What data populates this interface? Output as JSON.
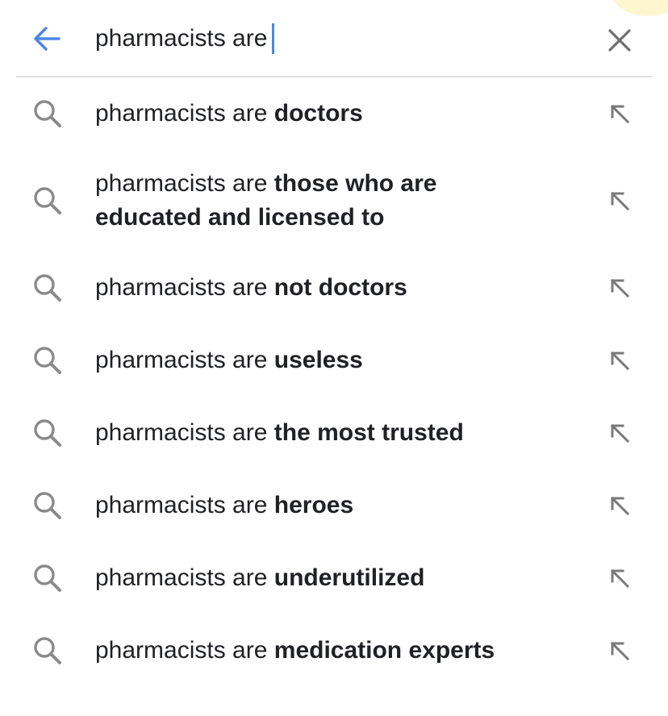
{
  "search": {
    "query": "pharmacists are",
    "back_icon": "arrow-left-icon",
    "clear_icon": "close-icon",
    "accent_color": "#4a86e8"
  },
  "suggestions": [
    {
      "prefix": "pharmacists are",
      "completion": "doctors"
    },
    {
      "prefix": "pharmacists are",
      "completion": "those who are educated and licensed to"
    },
    {
      "prefix": "pharmacists are",
      "completion": "not doctors"
    },
    {
      "prefix": "pharmacists are",
      "completion": "useless"
    },
    {
      "prefix": "pharmacists are",
      "completion": "the most trusted"
    },
    {
      "prefix": "pharmacists are",
      "completion": "heroes"
    },
    {
      "prefix": "pharmacists are",
      "completion": "underutilized"
    },
    {
      "prefix": "pharmacists are",
      "completion": "medication experts"
    }
  ],
  "icons": {
    "row_left": "search-icon",
    "row_right": "arrow-up-left-icon"
  }
}
